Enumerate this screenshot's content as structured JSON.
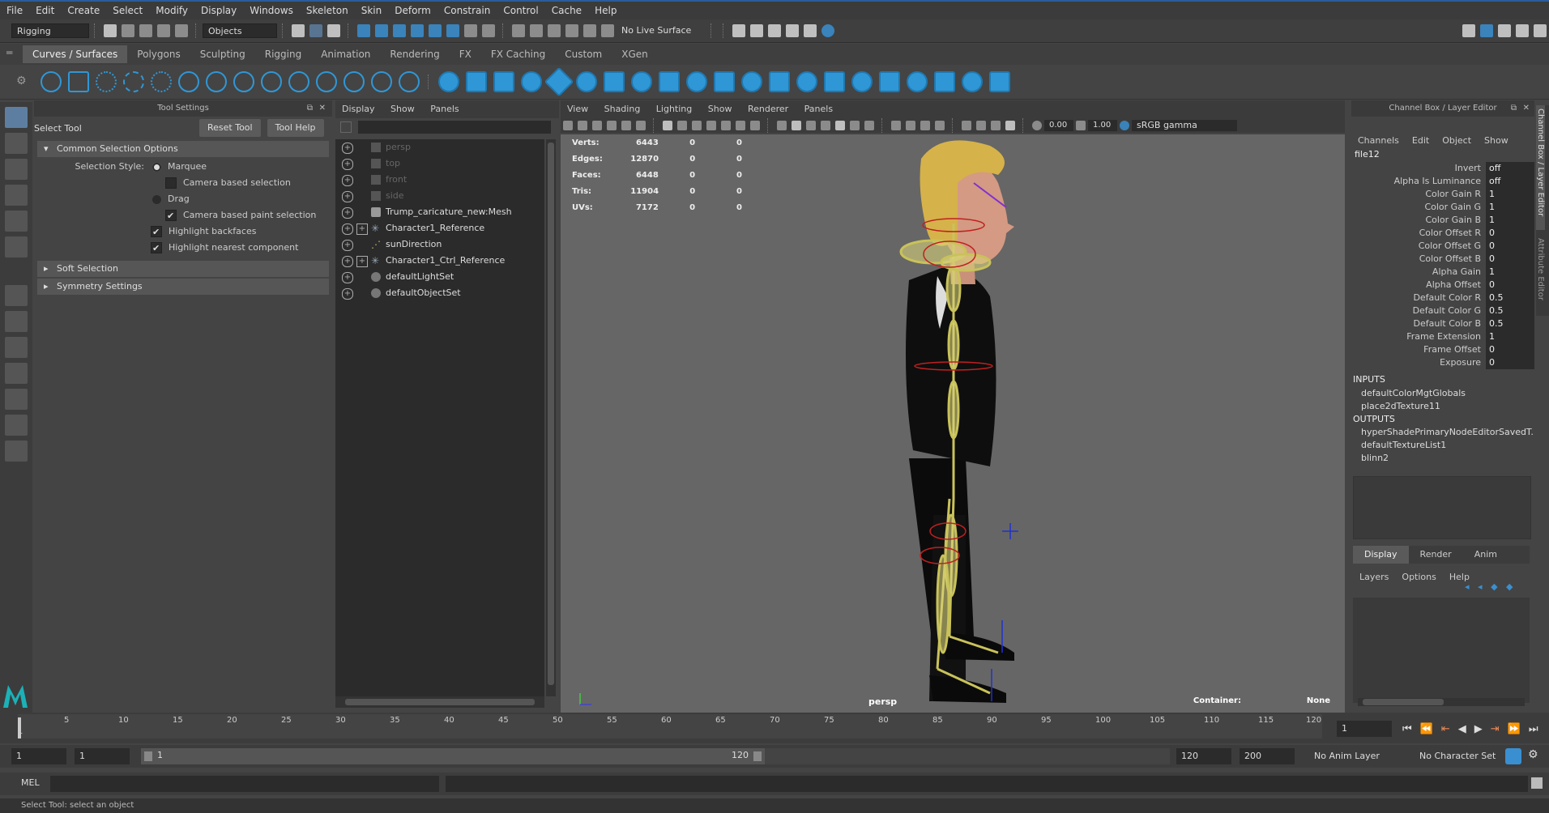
{
  "menubar": [
    "File",
    "Edit",
    "Create",
    "Select",
    "Modify",
    "Display",
    "Windows",
    "Skeleton",
    "Skin",
    "Deform",
    "Constrain",
    "Control",
    "Cache",
    "Help"
  ],
  "status": {
    "mode": "Rigging",
    "selection_mask": "Objects",
    "live_surface": "No Live Surface"
  },
  "shelf_tabs": [
    "Curves / Surfaces",
    "Polygons",
    "Sculpting",
    "Rigging",
    "Animation",
    "Rendering",
    "FX",
    "FX Caching",
    "Custom",
    "XGen"
  ],
  "tool_settings": {
    "panel_title": "Tool Settings",
    "tool_name": "Select Tool",
    "reset_button": "Reset Tool",
    "help_button": "Tool Help",
    "section_common": "Common Selection Options",
    "selection_style_label": "Selection Style:",
    "marquee": "Marquee",
    "camera_based_selection": "Camera based selection",
    "drag": "Drag",
    "camera_based_paint": "Camera based paint selection",
    "highlight_backfaces": "Highlight backfaces",
    "highlight_nearest": "Highlight nearest component",
    "section_soft": "Soft Selection",
    "section_symmetry": "Symmetry Settings"
  },
  "outliner": {
    "menu": [
      "Display",
      "Show",
      "Panels"
    ],
    "items": [
      {
        "label": "persp",
        "dim": true
      },
      {
        "label": "top",
        "dim": true
      },
      {
        "label": "front",
        "dim": true
      },
      {
        "label": "side",
        "dim": true
      },
      {
        "label": "Trump_caricature_new:Mesh",
        "dim": false
      },
      {
        "label": "Character1_Reference",
        "dim": false
      },
      {
        "label": "sunDirection",
        "dim": false
      },
      {
        "label": "Character1_Ctrl_Reference",
        "dim": false
      },
      {
        "label": "defaultLightSet",
        "dim": false
      },
      {
        "label": "defaultObjectSet",
        "dim": false
      }
    ]
  },
  "viewport": {
    "menu": [
      "View",
      "Shading",
      "Lighting",
      "Show",
      "Renderer",
      "Panels"
    ],
    "val1": "0.00",
    "val2": "1.00",
    "color_space": "sRGB gamma",
    "stats": [
      {
        "label": "Verts:",
        "v": "6443",
        "a": "0",
        "b": "0"
      },
      {
        "label": "Edges:",
        "v": "12870",
        "a": "0",
        "b": "0"
      },
      {
        "label": "Faces:",
        "v": "6448",
        "a": "0",
        "b": "0"
      },
      {
        "label": "Tris:",
        "v": "11904",
        "a": "0",
        "b": "0"
      },
      {
        "label": "UVs:",
        "v": "7172",
        "a": "0",
        "b": "0"
      }
    ],
    "camera": "persp",
    "container_label": "Container:",
    "container_value": "None"
  },
  "channel_box": {
    "title": "Channel Box / Layer Editor",
    "menu": [
      "Channels",
      "Edit",
      "Object",
      "Show"
    ],
    "node": "file12",
    "attrs": [
      {
        "n": "Invert",
        "v": "off"
      },
      {
        "n": "Alpha Is Luminance",
        "v": "off"
      },
      {
        "n": "Color Gain R",
        "v": "1"
      },
      {
        "n": "Color Gain G",
        "v": "1"
      },
      {
        "n": "Color Gain B",
        "v": "1"
      },
      {
        "n": "Color Offset R",
        "v": "0"
      },
      {
        "n": "Color Offset G",
        "v": "0"
      },
      {
        "n": "Color Offset B",
        "v": "0"
      },
      {
        "n": "Alpha Gain",
        "v": "1"
      },
      {
        "n": "Alpha Offset",
        "v": "0"
      },
      {
        "n": "Default Color R",
        "v": "0.5"
      },
      {
        "n": "Default Color G",
        "v": "0.5"
      },
      {
        "n": "Default Color B",
        "v": "0.5"
      },
      {
        "n": "Frame Extension",
        "v": "1"
      },
      {
        "n": "Frame Offset",
        "v": "0"
      },
      {
        "n": "Exposure",
        "v": "0"
      }
    ],
    "inputs_label": "INPUTS",
    "inputs": [
      "defaultColorMgtGlobals",
      "place2dTexture11"
    ],
    "outputs_label": "OUTPUTS",
    "outputs": [
      "hyperShadePrimaryNodeEditorSavedT...",
      "defaultTextureList1",
      "blinn2"
    ],
    "layer_tabs": [
      "Display",
      "Render",
      "Anim"
    ],
    "layer_menu": [
      "Layers",
      "Options",
      "Help"
    ],
    "side_tabs": [
      "Channel Box / Layer Editor",
      "Attribute Editor"
    ]
  },
  "timeline": {
    "ticks": [
      "1",
      "5",
      "10",
      "15",
      "20",
      "25",
      "30",
      "35",
      "40",
      "45",
      "50",
      "55",
      "60",
      "65",
      "70",
      "75",
      "80",
      "85",
      "90",
      "95",
      "100",
      "105",
      "110",
      "115",
      "120"
    ],
    "current_frame": "1"
  },
  "range": {
    "start": "1",
    "inner_start": "1",
    "slider_start": "1",
    "slider_end": "120",
    "end": "120",
    "max": "200",
    "anim_layer": "No Anim Layer",
    "char_set": "No Character Set"
  },
  "cmd": {
    "label": "MEL"
  },
  "help_line": "Select Tool: select an object"
}
